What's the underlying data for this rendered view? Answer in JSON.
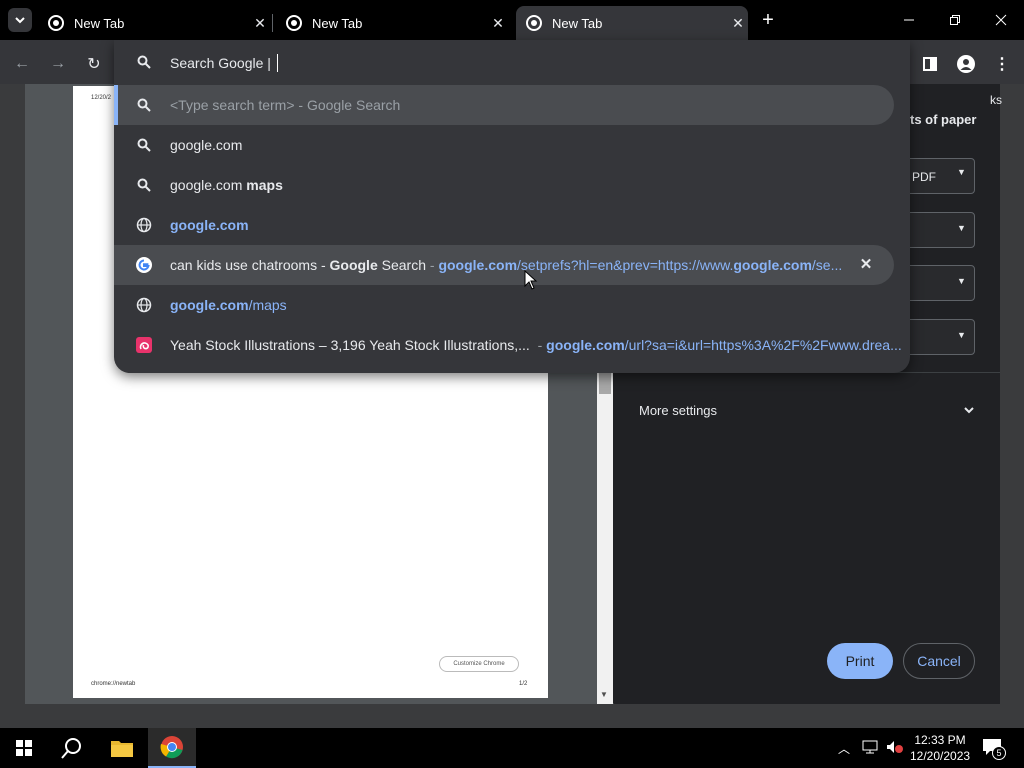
{
  "tabs": [
    {
      "title": "New Tab",
      "active": false
    },
    {
      "title": "New Tab",
      "active": false
    },
    {
      "title": "New Tab",
      "active": true
    }
  ],
  "omnibox": {
    "input_text": "Search Google |",
    "suggestions": [
      {
        "icon": "search-icon",
        "parts": [
          {
            "t": "<Type search term> - Google Search",
            "style": "dim"
          }
        ]
      },
      {
        "icon": "search-icon",
        "parts": [
          {
            "t": "google.com",
            "style": "normal"
          }
        ]
      },
      {
        "icon": "search-icon",
        "parts": [
          {
            "t": "google.com ",
            "style": "normal"
          },
          {
            "t": "maps",
            "style": "bold"
          }
        ]
      },
      {
        "icon": "globe-icon",
        "parts": [
          {
            "t": "google.com",
            "style": "blue-bold"
          }
        ]
      },
      {
        "icon": "google-g-icon",
        "parts": [
          {
            "t": "can kids use chatrooms - ",
            "style": "normal"
          },
          {
            "t": "Google",
            "style": "bold"
          },
          {
            "t": " Search",
            "style": "normal"
          },
          {
            "t": " - ",
            "style": "dim"
          },
          {
            "t": "google.com",
            "style": "blue-bold"
          },
          {
            "t": "/setprefs?hl=en&prev=https://www.",
            "style": "blue"
          },
          {
            "t": "google.com",
            "style": "blue-bold"
          },
          {
            "t": "/se...",
            "style": "blue"
          }
        ],
        "removable": true
      },
      {
        "icon": "globe-icon",
        "parts": [
          {
            "t": "google.com",
            "style": "blue-bold"
          },
          {
            "t": "/maps",
            "style": "blue"
          }
        ]
      },
      {
        "icon": "dreamstime-icon",
        "parts": [
          {
            "t": "Yeah Stock Illustrations – 3,196 Yeah Stock Illustrations,...",
            "style": "normal"
          },
          {
            "t": "  - ",
            "style": "dim"
          },
          {
            "t": "google.com",
            "style": "blue-bold"
          },
          {
            "t": "/url?sa=i&url=https%3A%2F%2Fwww.drea...",
            "style": "blue"
          }
        ]
      }
    ]
  },
  "print": {
    "destination_value": "PDF",
    "partial_label": "ts of paper",
    "bookmarks_partial": "ks",
    "more_settings": "More settings",
    "print_button": "Print",
    "cancel_button": "Cancel"
  },
  "preview": {
    "header_date": "12/20/2",
    "footer_url": "chrome://newtab",
    "page_number": "1/2",
    "customize_button": "Customize Chrome"
  },
  "taskbar": {
    "time": "12:33 PM",
    "date": "12/20/2023",
    "notification_count": "5"
  },
  "colors": {
    "accent_blue": "#8ab4f8",
    "print_button_bg": "#8ab4f8"
  }
}
